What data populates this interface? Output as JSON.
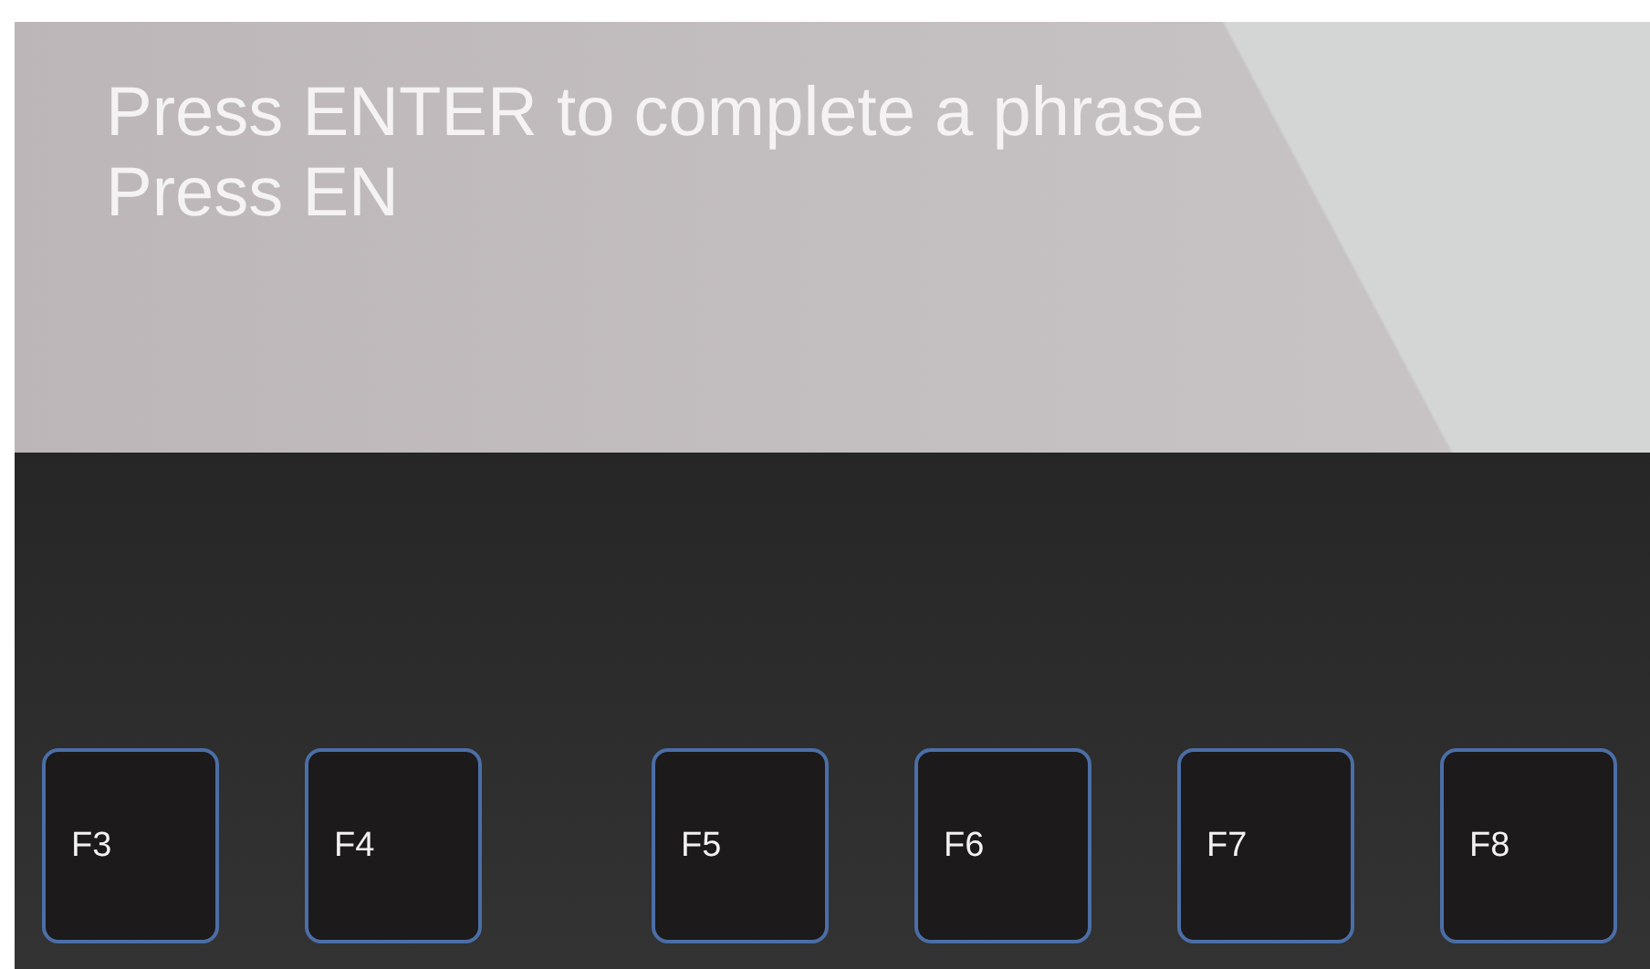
{
  "display": {
    "lines": [
      "Press ENTER to complete a phrase",
      "Press EN"
    ]
  },
  "key_groups": [
    [
      "F3",
      "F4"
    ],
    [
      "F5",
      "F6",
      "F7",
      "F8"
    ]
  ]
}
